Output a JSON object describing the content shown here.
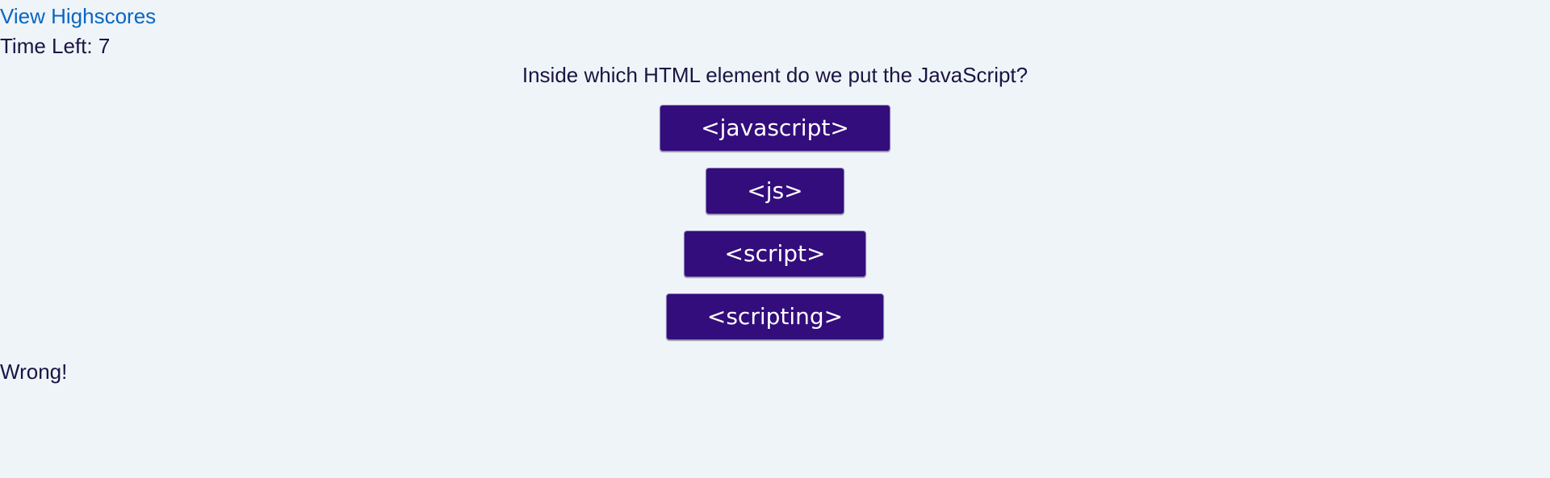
{
  "header": {
    "highscores_link": "View Highscores"
  },
  "timer": {
    "text": "Time Left: 7"
  },
  "quiz": {
    "question": "Inside which HTML element do we put the JavaScript?",
    "answers": [
      {
        "label": "<javascript>"
      },
      {
        "label": "<js>"
      },
      {
        "label": "<script>"
      },
      {
        "label": "<scripting>"
      }
    ]
  },
  "feedback": {
    "text": "Wrong!"
  },
  "colors": {
    "background": "#eff4f9",
    "link": "#0a66c2",
    "button_bg": "#330d7b",
    "button_text": "#ffffff",
    "text": "#1b1442"
  }
}
